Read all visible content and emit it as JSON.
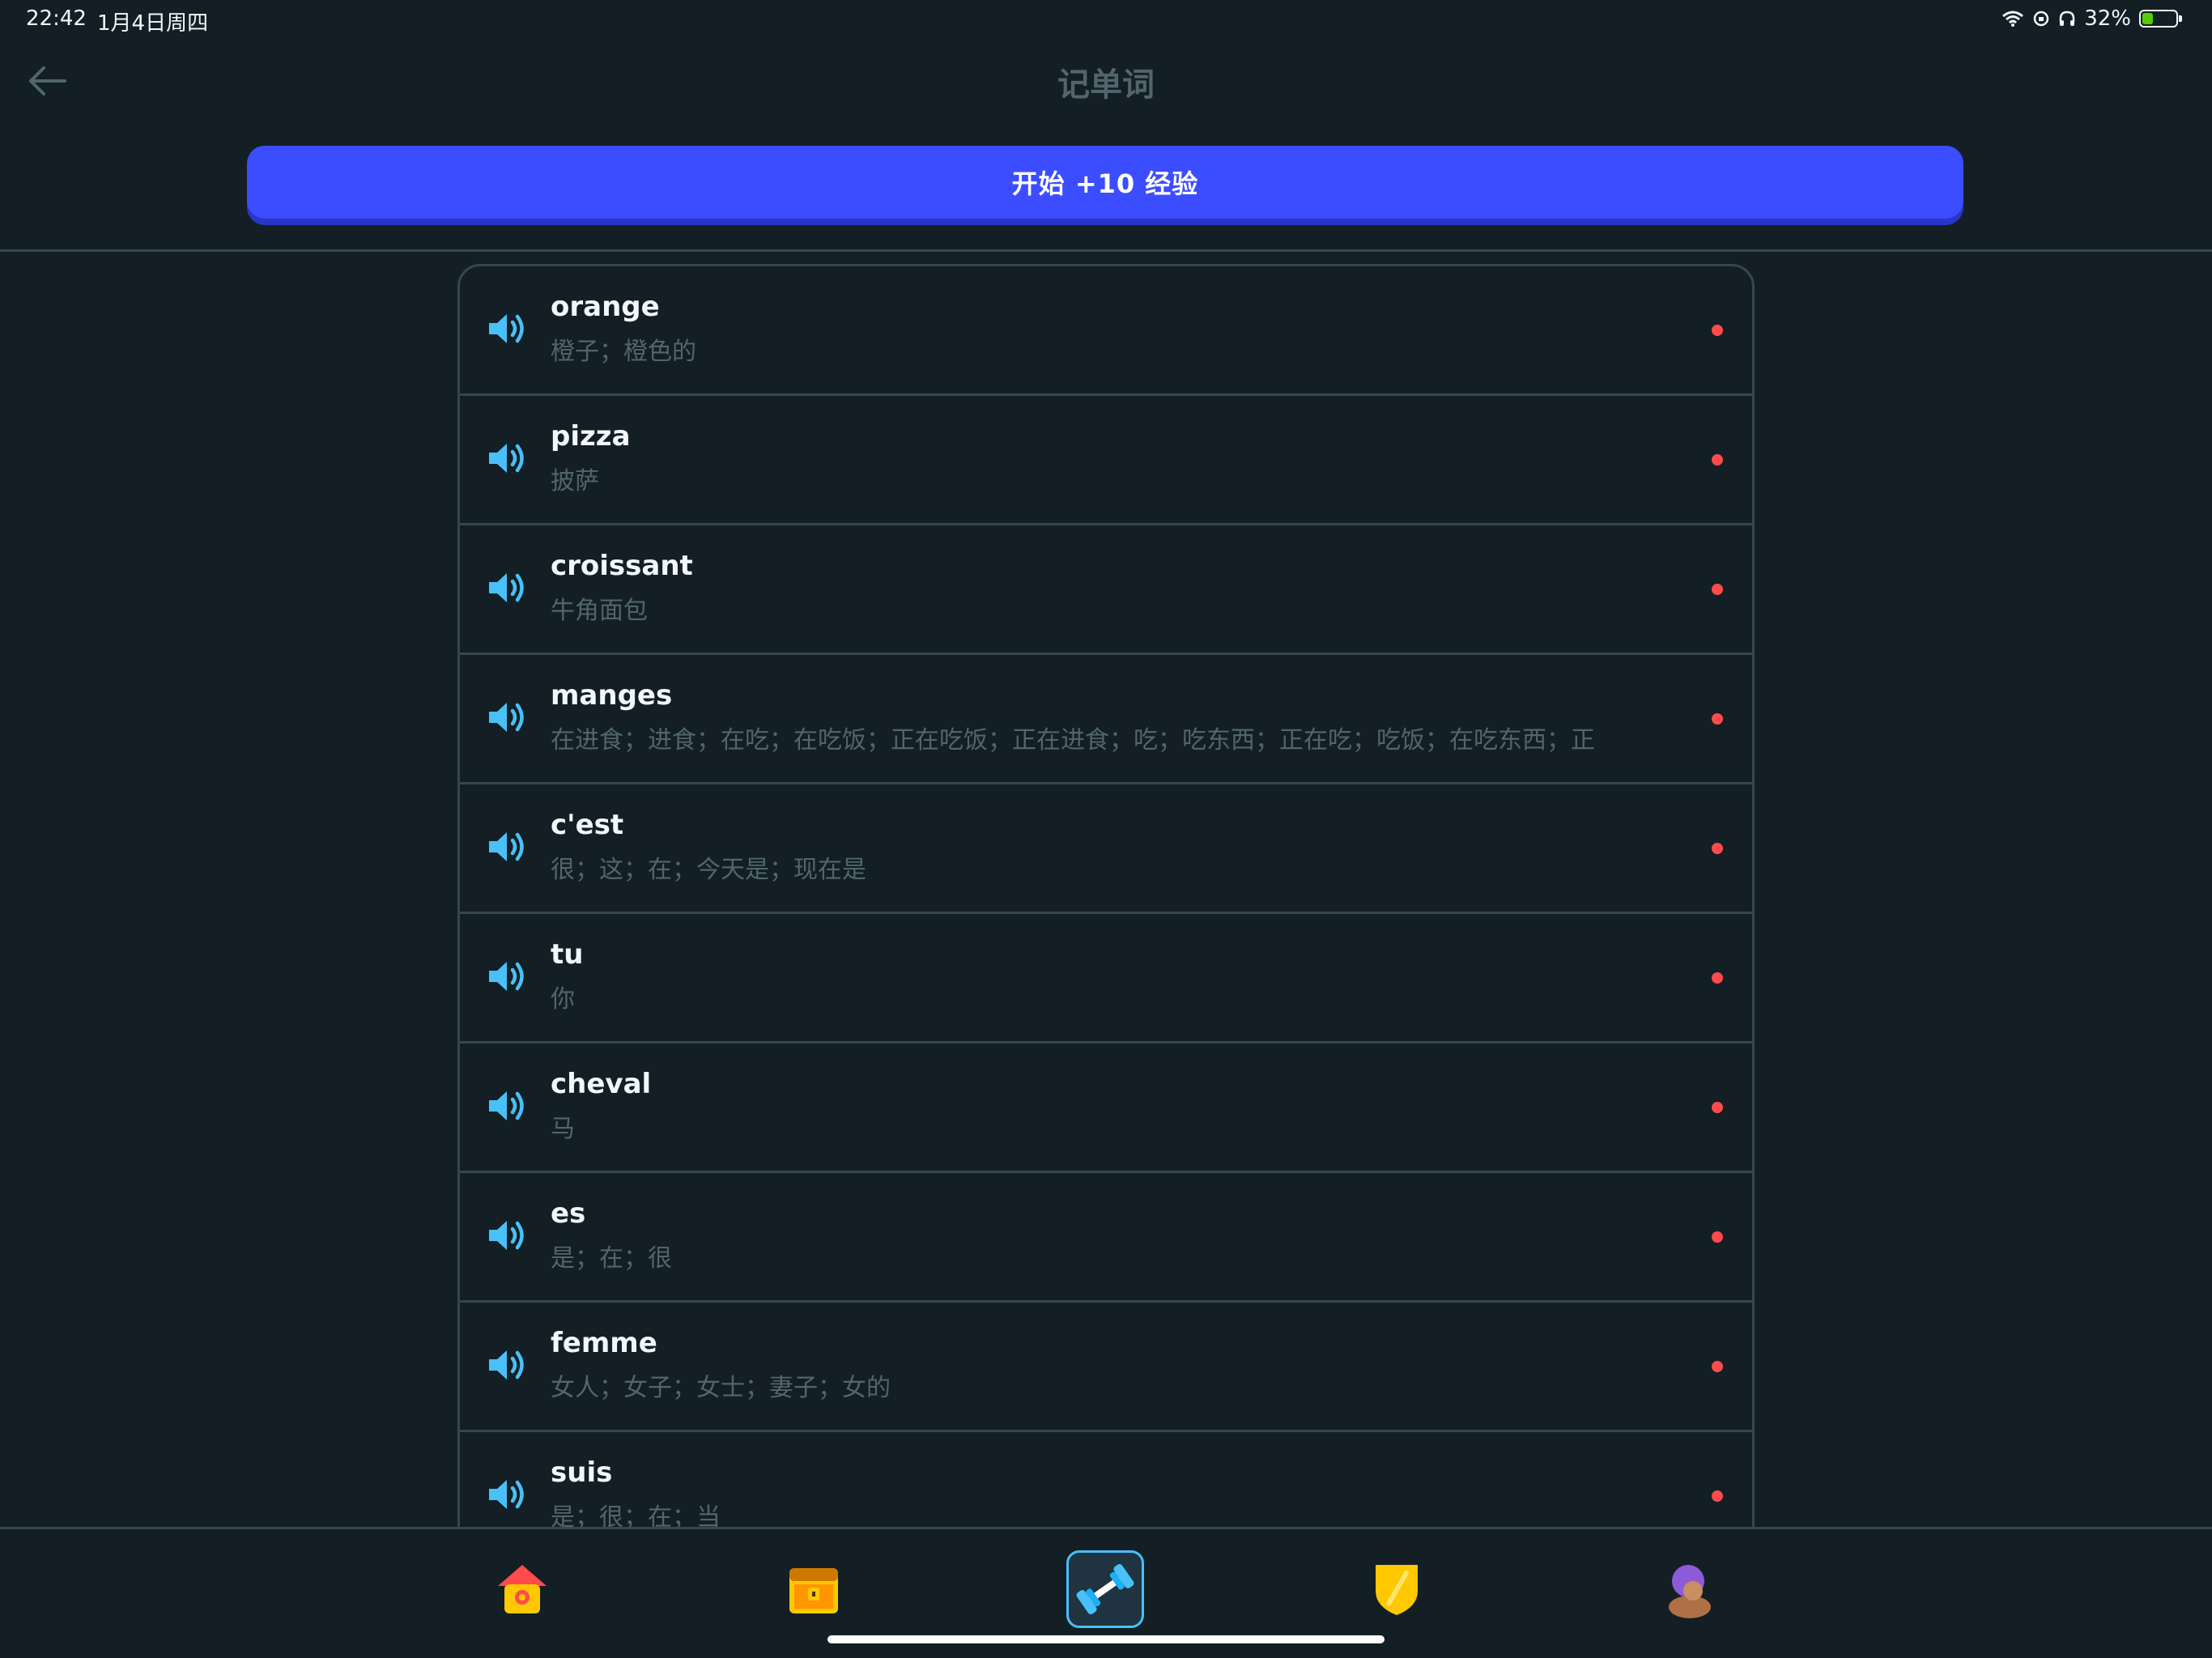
{
  "status": {
    "time": "22:42",
    "date": "1月4日周四",
    "battery_label": "32%",
    "battery_level": 0.32
  },
  "header": {
    "title": "记单词",
    "back_icon": "arrow-left-icon"
  },
  "start_button": {
    "label": "开始 +10 经验"
  },
  "words": [
    {
      "word": "orange",
      "meaning": "橙子；橙色的"
    },
    {
      "word": "pizza",
      "meaning": "披萨"
    },
    {
      "word": "croissant",
      "meaning": "牛角面包"
    },
    {
      "word": "manges",
      "meaning": "在进食；进食；在吃；在吃饭；正在吃饭；正在进食；吃；吃东西；正在吃；吃饭；在吃东西；正"
    },
    {
      "word": "c'est",
      "meaning": "很；这；在；今天是；现在是"
    },
    {
      "word": "tu",
      "meaning": "你"
    },
    {
      "word": "cheval",
      "meaning": "马"
    },
    {
      "word": "es",
      "meaning": "是；在；很"
    },
    {
      "word": "femme",
      "meaning": "女人；女子；女士；妻子；女的"
    },
    {
      "word": "suis",
      "meaning": "是；很；在；当"
    }
  ],
  "tabs": [
    {
      "name": "home",
      "icon": "house-icon"
    },
    {
      "name": "treasure",
      "icon": "treasure-chest-icon"
    },
    {
      "name": "practice",
      "icon": "dumbbell-icon",
      "active": true
    },
    {
      "name": "leagues",
      "icon": "shield-icon"
    },
    {
      "name": "profile",
      "icon": "avatar-icon"
    }
  ],
  "colors": {
    "background": "#131f24",
    "accent": "#3c4dff",
    "speaker": "#49c0f8",
    "dot": "#ff4b4b",
    "muted": "#52656d"
  }
}
